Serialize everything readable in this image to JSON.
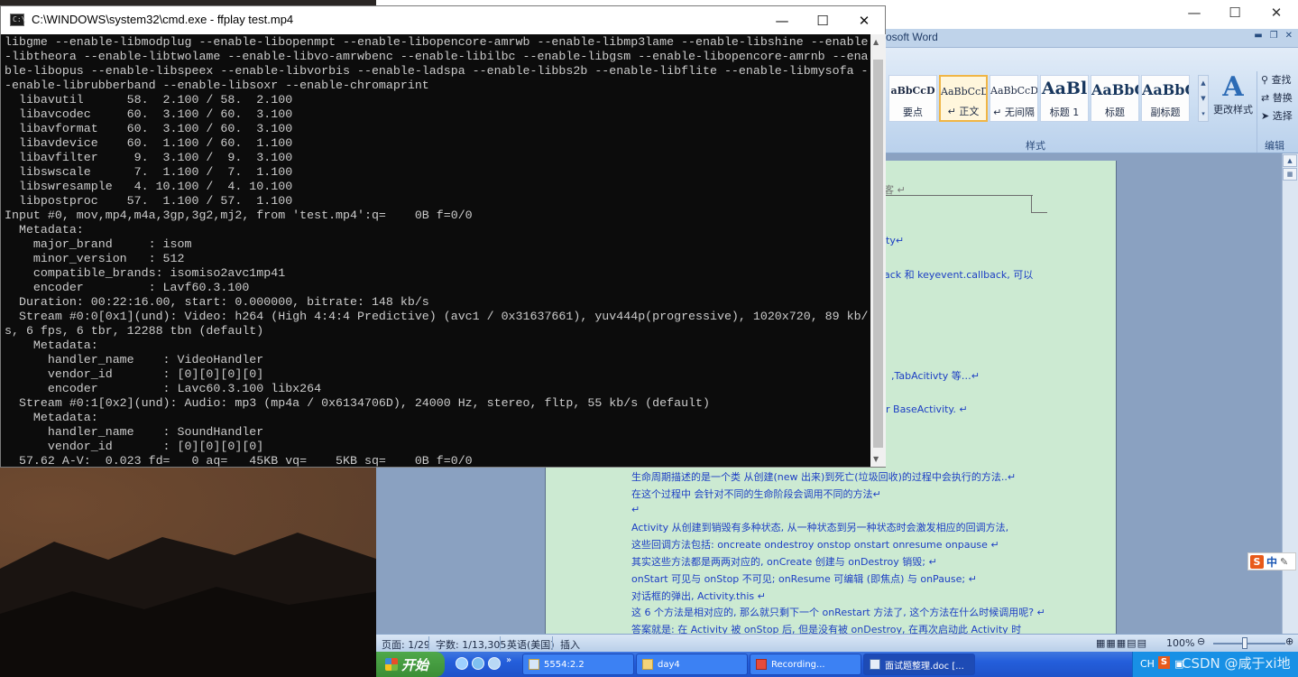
{
  "cmd": {
    "title": "C:\\WINDOWS\\system32\\cmd.exe - ffplay  test.mp4",
    "icon_text": "C:\\",
    "lines": [
      "libgme --enable-libmodplug --enable-libopenmpt --enable-libopencore-amrwb --enable-libmp3lame --enable-libshine --enable",
      "-libtheora --enable-libtwolame --enable-libvo-amrwbenc --enable-libilbc --enable-libgsm --enable-libopencore-amrnb --ena",
      "ble-libopus --enable-libspeex --enable-libvorbis --enable-ladspa --enable-libbs2b --enable-libflite --enable-libmysofa -",
      "-enable-librubberband --enable-libsoxr --enable-chromaprint",
      "  libavutil      58.  2.100 / 58.  2.100",
      "  libavcodec     60.  3.100 / 60.  3.100",
      "  libavformat    60.  3.100 / 60.  3.100",
      "  libavdevice    60.  1.100 / 60.  1.100",
      "  libavfilter     9.  3.100 /  9.  3.100",
      "  libswscale      7.  1.100 /  7.  1.100",
      "  libswresample   4. 10.100 /  4. 10.100",
      "  libpostproc    57.  1.100 / 57.  1.100",
      "Input #0, mov,mp4,m4a,3gp,3g2,mj2, from 'test.mp4':q=    0B f=0/0",
      "  Metadata:",
      "    major_brand     : isom",
      "    minor_version   : 512",
      "    compatible_brands: isomiso2avc1mp41",
      "    encoder         : Lavf60.3.100",
      "  Duration: 00:22:16.00, start: 0.000000, bitrate: 148 kb/s",
      "  Stream #0:0[0x1](und): Video: h264 (High 4:4:4 Predictive) (avc1 / 0x31637661), yuv444p(progressive), 1020x720, 89 kb/",
      "s, 6 fps, 6 tbr, 12288 tbn (default)",
      "    Metadata:",
      "      handler_name    : VideoHandler",
      "      vendor_id       : [0][0][0][0]",
      "      encoder         : Lavc60.3.100 libx264",
      "  Stream #0:1[0x2](und): Audio: mp3 (mp4a / 0x6134706D), 24000 Hz, stereo, fltp, 55 kb/s (default)",
      "    Metadata:",
      "      handler_name    : SoundHandler",
      "      vendor_id       : [0][0][0][0]",
      "  57.62 A-V:  0.023 fd=   0 aq=   45KB vq=    5KB sq=    0B f=0/0"
    ]
  },
  "word": {
    "app_name": "osoft Word",
    "styles": [
      {
        "sample": "aBbCcD",
        "name": "要点"
      },
      {
        "sample": "AaBbCcDc",
        "name": "↵ 正文"
      },
      {
        "sample": "AaBbCcDc",
        "name": "↵ 无间隔"
      },
      {
        "sample": "AaBl",
        "name": "标题 1"
      },
      {
        "sample": "AaBbC",
        "name": "标题"
      },
      {
        "sample": "AaBbC",
        "name": "副标题"
      }
    ],
    "change_styles_label": "更改样式",
    "styles_group_label": "样式",
    "editing": {
      "find": "查找",
      "replace": "替换",
      "select": "选择",
      "group_label": "编辑"
    },
    "doc_lines": [
      {
        "text": "客 ↵",
        "cls": "gray"
      },
      {
        "text": "ty↵",
        "cls": ""
      },
      {
        "text": "ack 和 keyevent.callback, 可以",
        "cls": ""
      },
      {
        "text": ",TabAcitivty 等…↵",
        "cls": ""
      },
      {
        "text": "r BaseActivity. ↵",
        "cls": ""
      },
      {
        "text": "生命周期描述的是一个类 从创建(new 出来)到死亡(垃圾回收)的过程中会执行的方法..↵",
        "cls": ""
      },
      {
        "text": "在这个过程中 会针对不同的生命阶段会调用不同的方法↵",
        "cls": ""
      },
      {
        "text": "↵",
        "cls": ""
      },
      {
        "text": "Activity 从创建到销毁有多种状态, 从一种状态到另一种状态时会激发相应的回调方法,",
        "cls": ""
      },
      {
        "text": "这些回调方法包括: oncreate ondestroy onstop onstart onresume onpause ↵",
        "cls": ""
      },
      {
        "text": "其实这些方法都是两两对应的, onCreate 创建与 onDestroy 销毁; ↵",
        "cls": ""
      },
      {
        "text": "onStart 可见与 onStop 不可见; onResume 可编辑 (即焦点) 与 onPause; ↵",
        "cls": ""
      },
      {
        "text": "对话框的弹出, Activity.this ↵",
        "cls": ""
      },
      {
        "text": "这 6 个方法是相对应的, 那么就只剩下一个 onRestart 方法了, 这个方法在什么时候调用呢? ↵",
        "cls": ""
      },
      {
        "text": "答案就是: 在 Activity 被 onStop 后, 但是没有被 onDestroy, 在再次启动此 Activity 时",
        "cls": ""
      }
    ],
    "status": {
      "page": "页面: 1/29",
      "words": "字数: 1/13,305",
      "language": "英语(美国)",
      "mode": "插入",
      "zoom": "100%"
    },
    "zoom_level": 1.0
  },
  "ime": {
    "logo": "S",
    "mode": "中"
  },
  "taskbar": {
    "start_label": "开始",
    "tasks": [
      {
        "label": "5554:2.2"
      },
      {
        "label": "day4"
      },
      {
        "label": "Recording..."
      },
      {
        "label": "面试题整理.doc [..."
      }
    ],
    "tray_lang": "CH",
    "watermark": "CSDN @咸于xi地"
  }
}
